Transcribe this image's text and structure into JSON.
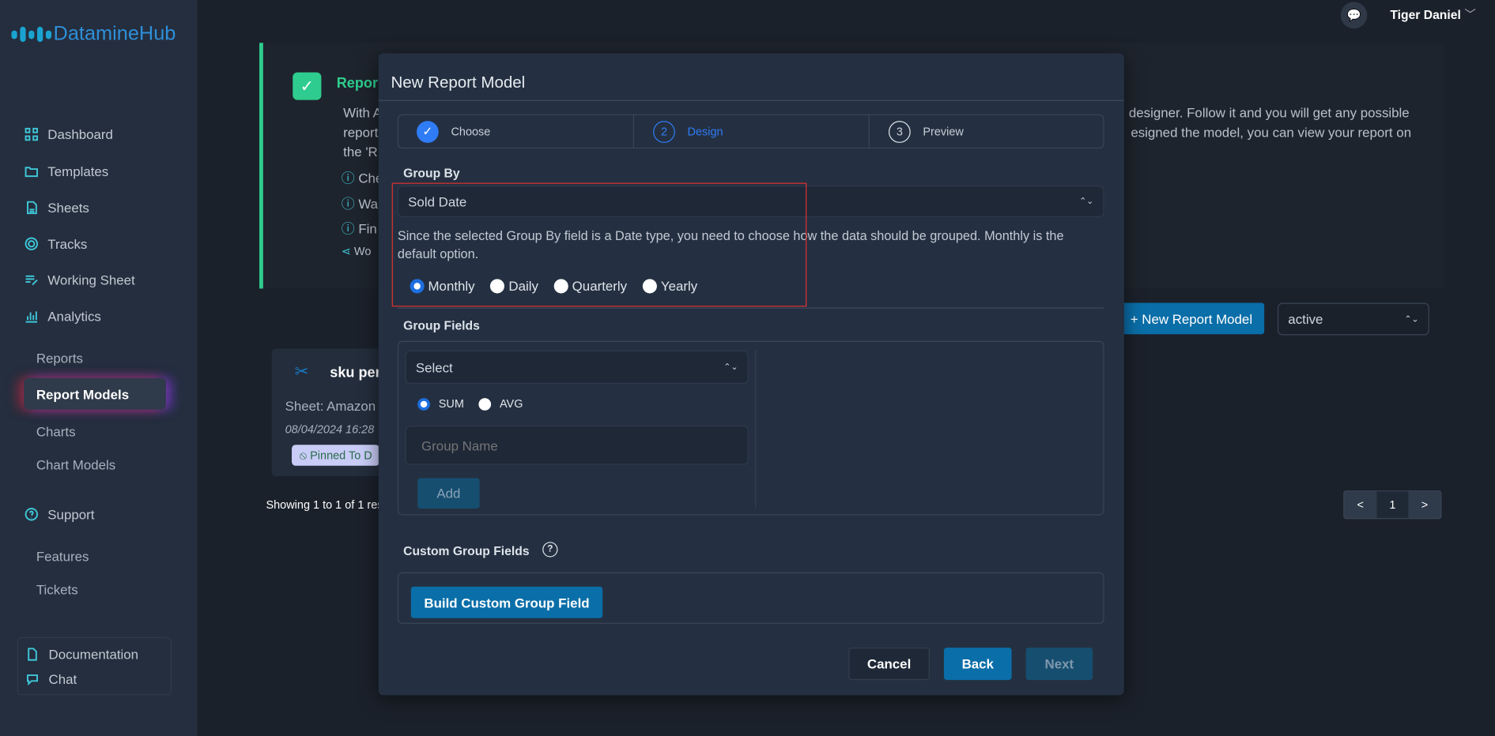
{
  "app": {
    "name": "DatamineHub"
  },
  "header": {
    "user_name": "Tiger Daniel"
  },
  "sidebar": {
    "items": [
      {
        "label": "Dashboard",
        "icon": "grid-icon"
      },
      {
        "label": "Templates",
        "icon": "folder-icon"
      },
      {
        "label": "Sheets",
        "icon": "file-icon"
      },
      {
        "label": "Tracks",
        "icon": "radar-icon"
      },
      {
        "label": "Working Sheet",
        "icon": "list-edit-icon"
      },
      {
        "label": "Analytics",
        "icon": "bar-chart-icon"
      }
    ],
    "analytics_sub": [
      "Reports",
      "Report Models",
      "Charts",
      "Chart Models"
    ],
    "support": "Support",
    "support_sub": [
      "Features",
      "Tickets"
    ],
    "footer": {
      "documentation": "Documentation",
      "chat": "Chat"
    }
  },
  "info": {
    "title": "Repor",
    "line1_left": "With A",
    "line2_left": "report",
    "line3_left": "the 'R",
    "line1_right": "designer. Follow it and you will get any possible",
    "line2_right": "esigned the model, you can view your report on",
    "bullets": [
      "Che",
      "Wa",
      "Fin",
      "Wo"
    ]
  },
  "toolbar": {
    "new_button": "+ New Report Model",
    "status_select": "active"
  },
  "card": {
    "title": "sku per",
    "sheet": "Sheet: Amazon",
    "date": "08/04/2024 16:28",
    "badge": "Pinned To D"
  },
  "pagination": {
    "summary": "Showing 1 to 1 of 1 res",
    "prev": "<",
    "page": "1",
    "next": ">"
  },
  "modal": {
    "title": "New Report Model",
    "steps": [
      {
        "num": "",
        "label": "Choose",
        "state": "done"
      },
      {
        "num": "2",
        "label": "Design",
        "state": "active"
      },
      {
        "num": "3",
        "label": "Preview",
        "state": "pending"
      }
    ],
    "group_by": {
      "label": "Group By",
      "value": "Sold Date",
      "help": "Since the selected Group By field is a Date type, you need to choose how the data should be grouped. Monthly is the default option.",
      "options": [
        "Monthly",
        "Daily",
        "Quarterly",
        "Yearly"
      ],
      "selected": "Monthly"
    },
    "group_fields": {
      "label": "Group Fields",
      "select_placeholder": "Select",
      "agg_options": [
        "SUM",
        "AVG"
      ],
      "agg_selected": "SUM",
      "name_placeholder": "Group Name",
      "add": "Add"
    },
    "custom": {
      "label": "Custom Group Fields",
      "build": "Build Custom Group Field"
    },
    "footer": {
      "cancel": "Cancel",
      "back": "Back",
      "next": "Next"
    }
  },
  "colors": {
    "accent": "#0a6ea8",
    "success": "#2ecc8e",
    "highlight": "#e03030",
    "step_active": "#2f7cf6"
  }
}
